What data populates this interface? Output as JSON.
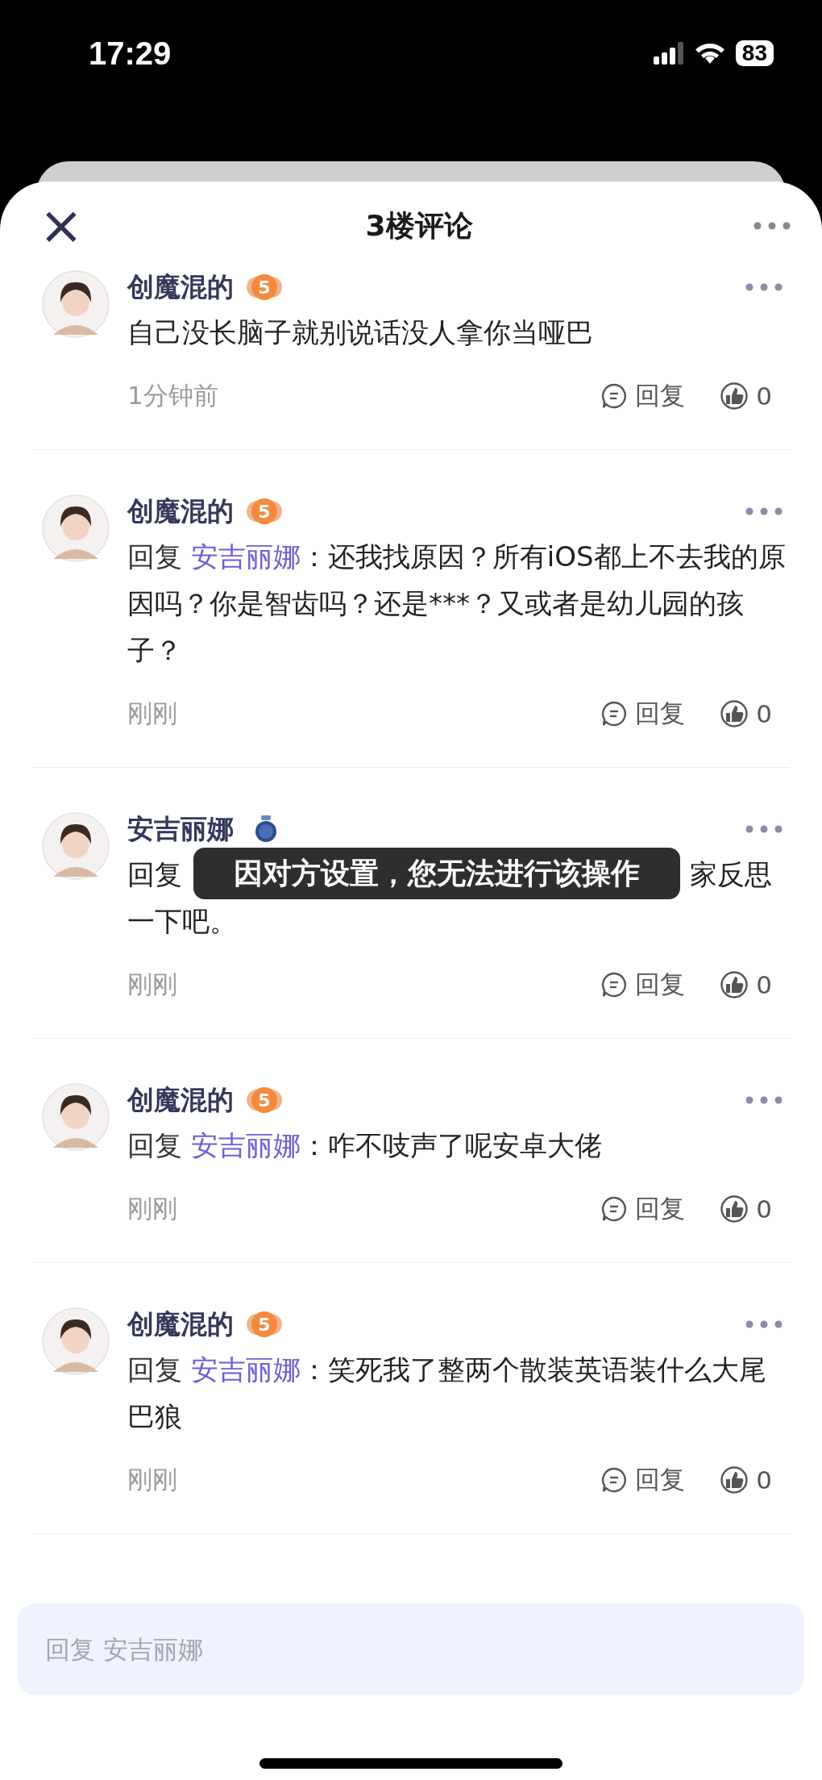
{
  "status_bar": {
    "time": "17:29",
    "battery": "83"
  },
  "header": {
    "title": "3楼评论",
    "close_glyph": "×"
  },
  "comments": [
    {
      "author": "创魔混的",
      "badge": {
        "kind": "wing",
        "text": "5"
      },
      "body": [
        {
          "kind": "text",
          "text": "自己没长脑子就别说话没人拿你当哑巴"
        }
      ],
      "time": "1分钟前",
      "reply_label": "回复",
      "likes": "0"
    },
    {
      "author": "创魔混的",
      "badge": {
        "kind": "wing",
        "text": "5"
      },
      "body": [
        {
          "kind": "prefix",
          "text": "回复 "
        },
        {
          "kind": "mention",
          "text": "安吉丽娜"
        },
        {
          "kind": "text",
          "text": "：还我找原因？所有iOS都上不去我的原因吗？你是智齿吗？还是***？又或者是幼儿园的孩子？"
        }
      ],
      "time": "刚刚",
      "reply_label": "回复",
      "likes": "0"
    },
    {
      "author": "安吉丽娜",
      "badge": {
        "kind": "medal"
      },
      "covered_lines": [
        {
          "left": "回复",
          "right": "家反思"
        },
        {
          "left": "一下吧。"
        }
      ],
      "time": "刚刚",
      "reply_label": "回复",
      "likes": "0"
    },
    {
      "author": "创魔混的",
      "badge": {
        "kind": "wing",
        "text": "5"
      },
      "body": [
        {
          "kind": "prefix",
          "text": "回复 "
        },
        {
          "kind": "mention",
          "text": "安吉丽娜"
        },
        {
          "kind": "text",
          "text": "：咋不吱声了呢安卓大佬"
        }
      ],
      "time": "刚刚",
      "reply_label": "回复",
      "likes": "0"
    },
    {
      "author": "创魔混的",
      "badge": {
        "kind": "wing",
        "text": "5"
      },
      "body": [
        {
          "kind": "prefix",
          "text": "回复 "
        },
        {
          "kind": "mention",
          "text": "安吉丽娜"
        },
        {
          "kind": "text",
          "text": "：笑死我了整两个散装英语装什么大尾巴狼"
        }
      ],
      "time": "刚刚",
      "reply_label": "回复",
      "likes": "0"
    }
  ],
  "toast": {
    "text": "因对方设置，您无法进行该操作"
  },
  "reply_field": {
    "placeholder": "回复 安吉丽娜"
  }
}
